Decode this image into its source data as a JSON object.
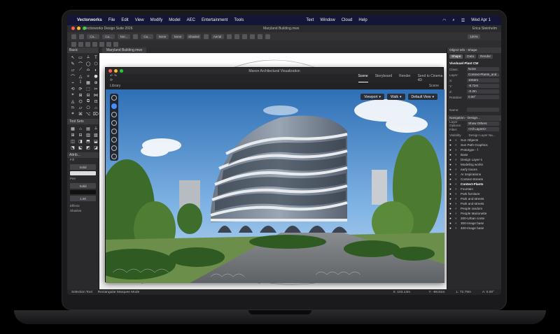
{
  "menubar": {
    "app": "Vectorworks",
    "items": [
      "File",
      "Edit",
      "View",
      "Modify",
      "Model",
      "AEC",
      "Entertainment",
      "Tools",
      "Text",
      "Window",
      "Cloud",
      "Help"
    ],
    "clock": "Wed Apr 1",
    "user": "Erica Steinhelm"
  },
  "vw": {
    "app_title": "Vectorworks Design Suite 2026",
    "file_title": "Maryland Building.mwx",
    "doc_tab": "Maryland Building.mwx",
    "zoom": "100%"
  },
  "toolbar": {
    "class_label": "None",
    "layer_label": "None",
    "render_mode": "Shaded",
    "view_label": "Aerial",
    "field_a": "Ca...",
    "field_b": "Ca...",
    "field_c": "Ca...",
    "field_d": "Nor..."
  },
  "left_panel": {
    "basic_title": "Basic",
    "toolsets_title": "Tool Sets",
    "attributes_title": "Attrib...",
    "fill_label": "Fill",
    "fill_value": "Solid",
    "pen_label": "Pen",
    "pen_value": "Solid",
    "effects_label": "Effects",
    "shadow_label": "Shadow",
    "opacity_value": "1.00",
    "basic_tools": [
      "↖",
      "▭",
      "⟂",
      "T",
      "✎",
      "⌒",
      "◯",
      "⬡",
      "▱",
      "⟋",
      "⌓",
      "◐",
      "⌒",
      "△",
      "✧",
      "⬣",
      "⌁",
      "⟟",
      "▦",
      "⊕",
      "⟲",
      "⟳",
      "⬚",
      "✂",
      "⌖",
      "⊞",
      "⊟",
      "⋈",
      "◬",
      "⌬",
      "⧉",
      "⊡",
      "⏢",
      "⏥",
      "⎔",
      "⌂",
      "⌗",
      "⌘",
      "⌥",
      "⌦"
    ],
    "toolset_tools": [
      "▦",
      "⌂",
      "▤",
      "⟂",
      "⊞",
      "⊟",
      "▥",
      "▧",
      "◫",
      "◨",
      "⬒",
      "⬓",
      "⬔",
      "⬕",
      "◩",
      "◪"
    ]
  },
  "viz": {
    "title": "Maxon Architectural Visualization",
    "tabs": [
      "Scene",
      "Storyboard",
      "Render"
    ],
    "active_tab": "Scene",
    "send_label": "Send to Cinema 4D",
    "library_label": "Library",
    "scene_label": "Scene",
    "viewport_label": "Viewport",
    "walk_label": "Walk",
    "view_label": "Default View"
  },
  "right_panel": {
    "obj_info_title": "Object Info - Shape",
    "tabs": [
      "Shape",
      "Data",
      "Render"
    ],
    "object_name": "Vivoluxel Plant CW",
    "class_label": "Class:",
    "class_value": "None",
    "layer_label": "Layer:",
    "layer_value": "Context-Plants_and...",
    "x_label": "X:",
    "x_value": "1063m",
    "y_label": "Y:",
    "y_value": "-8.72m",
    "z_label": "Z:",
    "z_value": "-0.3m",
    "rotation_label": "Rotation:",
    "rotation_value": "0.00°",
    "name_label": "Name:",
    "nav_title": "Navigation - Design...",
    "layer_options_label": "Layer Options:",
    "layer_options_value": "Show Others",
    "filter_label": "Filter:",
    "filter_value": "<All Layers>",
    "visibility_header": "Visibility",
    "layer_header": "Design Layer Na...",
    "layers": [
      {
        "name": "Sun Objects",
        "eye": "●",
        "bold": false
      },
      {
        "name": "Sun Path Graphics",
        "eye": "●",
        "bold": false
      },
      {
        "name": "Prototype - f",
        "eye": "●",
        "bold": false
      },
      {
        "name": "Base",
        "eye": "●",
        "bold": false
      },
      {
        "name": "Design Layer-1",
        "eye": "●",
        "bold": false
      },
      {
        "name": "Modeling works",
        "eye": "●",
        "bold": false
      },
      {
        "name": "early traces",
        "eye": "●",
        "bold": false
      },
      {
        "name": "AI Inspirations",
        "eye": "●",
        "bold": false
      },
      {
        "name": "Context-Streets",
        "eye": "●",
        "bold": false
      },
      {
        "name": "Context-Plants",
        "eye": "●",
        "bold": true
      },
      {
        "name": "Fountain",
        "eye": "●",
        "bold": false
      },
      {
        "name": "Park furniture",
        "eye": "●",
        "bold": false
      },
      {
        "name": "Park and streets",
        "eye": "●",
        "bold": false
      },
      {
        "name": "Park and streets",
        "eye": "●",
        "bold": false
      },
      {
        "name": "People random",
        "eye": "●",
        "bold": false
      },
      {
        "name": "People Marionette",
        "eye": "●",
        "bold": false
      },
      {
        "name": "200-Urban conte",
        "eye": "●",
        "bold": false
      },
      {
        "name": "300-Image base",
        "eye": "●",
        "bold": false
      },
      {
        "name": "400-Image base",
        "eye": "●",
        "bold": false
      }
    ]
  },
  "status": {
    "tool": "Selection Tool",
    "mode": "Rectangular Marquee Mode",
    "x": "X: 103.13m",
    "y": "Y: -98.81m",
    "l": "L: 72.79m",
    "a": "A: 0.00°"
  },
  "colors": {
    "accent": "#4a8cff",
    "menubar": "#1e1e4a",
    "panel": "#2a2a2c"
  }
}
